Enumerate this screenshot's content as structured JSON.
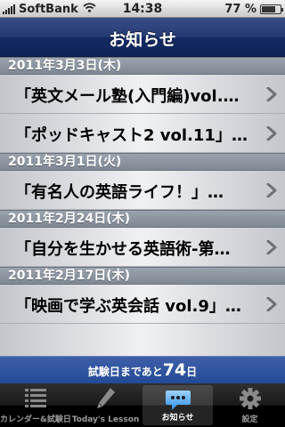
{
  "status_bar": {
    "carrier": "SoftBank",
    "time": "14:38",
    "battery": "77 %",
    "battery_level": 0.77
  },
  "nav": {
    "title": "お知らせ"
  },
  "sections": [
    {
      "date": "2011年3月3日(木)",
      "items": [
        "「英文メール塾(入門編)vol.…",
        "「ポッドキャスト2 vol.11」…"
      ]
    },
    {
      "date": "2011年3月1日(火)",
      "items": [
        "「有名人の英語ライフ！」…"
      ]
    },
    {
      "date": "2011年2月24日(木)",
      "items": [
        "「自分を生かせる英語術-第…"
      ]
    },
    {
      "date": "2011年2月17日(木)",
      "items": [
        "「映画で学ぶ英会話 vol.9」…"
      ]
    }
  ],
  "countdown": {
    "prefix": "試験日まであと",
    "days": "74",
    "suffix": "日"
  },
  "tabs": [
    {
      "label": "カレンダー&試験日",
      "icon": "list-icon"
    },
    {
      "label": "Today's Lesson",
      "icon": "pencil-icon"
    },
    {
      "label": "お知らせ",
      "icon": "chat-bubble-icon",
      "active": true
    },
    {
      "label": "設定",
      "icon": "gear-icon"
    }
  ]
}
